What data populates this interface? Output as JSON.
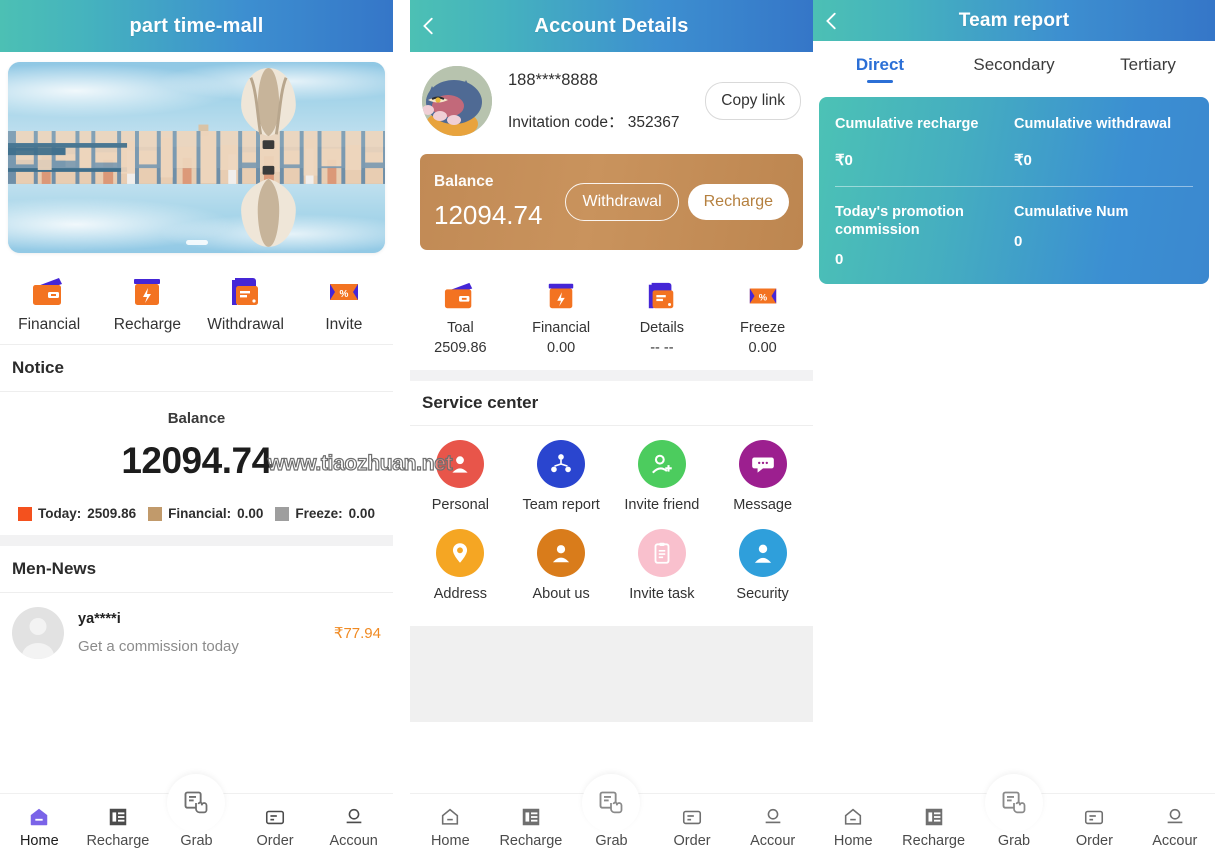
{
  "panel1": {
    "header": {
      "title": "part time-mall"
    },
    "hero": {
      "icon": "city-banner-image",
      "indicator": "carousel-dot"
    },
    "quick_actions": [
      {
        "label": "Financial",
        "icon": "wallet-icon"
      },
      {
        "label": "Recharge",
        "icon": "recharge-icon"
      },
      {
        "label": "Withdrawal",
        "icon": "withdrawal-icon"
      },
      {
        "label": "Invite",
        "icon": "coupon-percent-icon"
      }
    ],
    "notice_title": "Notice",
    "balance": {
      "caption": "Balance",
      "value": "12094.74",
      "legend": [
        {
          "label": "Today:",
          "value": "2509.86",
          "color": "#f4511e"
        },
        {
          "label": "Financial:",
          "value": "0.00",
          "color": "#c19a6b"
        },
        {
          "label": "Freeze:",
          "value": "0.00",
          "color": "#9e9e9e"
        }
      ]
    },
    "news_title": "Men-News",
    "news": [
      {
        "name": "ya****i",
        "text": "Get a commission today",
        "amount": "₹77.94"
      }
    ],
    "tabbar": [
      {
        "label": "Home",
        "icon": "home-icon",
        "active": true
      },
      {
        "label": "Recharge",
        "icon": "receipt-icon",
        "active": false
      },
      {
        "label": "Grab",
        "icon": "grab-hand-icon",
        "active": false
      },
      {
        "label": "Order",
        "icon": "order-list-icon",
        "active": false
      },
      {
        "label": "Accoun",
        "icon": "account-person-icon",
        "active": false
      }
    ]
  },
  "panel2": {
    "header": {
      "title": "Account Details",
      "back_icon": "chevron-left-icon"
    },
    "account": {
      "avatar": "cat-avatar",
      "phone": "188****8888",
      "invitation_label": "Invitation code：",
      "invitation_code": "352367",
      "copy_label": "Copy link"
    },
    "balance_card": {
      "caption": "Balance",
      "value": "12094.74",
      "withdrawal_label": "Withdrawal",
      "recharge_label": "Recharge",
      "card_color": "#c38f58"
    },
    "stats": [
      {
        "label": "Toal",
        "value": "2509.86",
        "icon": "wallet-icon"
      },
      {
        "label": "Financial",
        "value": "0.00",
        "icon": "recharge-icon"
      },
      {
        "label": "Details",
        "value": "-- --",
        "icon": "withdrawal-icon"
      },
      {
        "label": "Freeze",
        "value": "0.00",
        "icon": "coupon-percent-icon"
      }
    ],
    "service_title": "Service center",
    "services": [
      {
        "label": "Personal",
        "icon": "person-circle-icon",
        "color": "#e8554a"
      },
      {
        "label": "Team report",
        "icon": "team-network-icon",
        "color": "#2a45cf"
      },
      {
        "label": "Invite friend",
        "icon": "person-add-icon",
        "color": "#4ccc5e"
      },
      {
        "label": "Message",
        "icon": "chat-bubble-icon",
        "color": "#9c1f8f"
      },
      {
        "label": "Address",
        "icon": "location-pin-icon",
        "color": "#f5a623"
      },
      {
        "label": "About us",
        "icon": "person-icon",
        "color": "#d97c1b"
      },
      {
        "label": "Invite task",
        "icon": "clipboard-icon",
        "color": "#f9c0cd"
      },
      {
        "label": "Security",
        "icon": "person-shield-icon",
        "color": "#2f9fdb"
      }
    ],
    "tabbar": [
      {
        "label": "Home",
        "icon": "home-icon",
        "active": false
      },
      {
        "label": "Recharge",
        "icon": "receipt-icon",
        "active": false
      },
      {
        "label": "Grab",
        "icon": "grab-hand-icon",
        "active": false
      },
      {
        "label": "Order",
        "icon": "order-list-icon",
        "active": false
      },
      {
        "label": "Accour",
        "icon": "account-person-icon",
        "active": false
      }
    ]
  },
  "panel3": {
    "header": {
      "title": "Team report",
      "back_icon": "chevron-left-icon"
    },
    "tabs": [
      {
        "label": "Direct",
        "active": true
      },
      {
        "label": "Secondary",
        "active": false
      },
      {
        "label": "Tertiary",
        "active": false
      }
    ],
    "report": {
      "cells": [
        {
          "key": "Cumulative recharge",
          "value": "₹0"
        },
        {
          "key": "Cumulative withdrawal",
          "value": "₹0"
        },
        {
          "key": "Today's promotion commission",
          "value": "0"
        },
        {
          "key": "Cumulative Num",
          "value": "0"
        }
      ]
    },
    "tabbar": [
      {
        "label": "Home",
        "icon": "home-icon",
        "active": false
      },
      {
        "label": "Recharge",
        "icon": "receipt-icon",
        "active": false
      },
      {
        "label": "Grab",
        "icon": "grab-hand-icon",
        "active": false
      },
      {
        "label": "Order",
        "icon": "order-list-icon",
        "active": false
      },
      {
        "label": "Accour",
        "icon": "account-person-icon",
        "active": false
      }
    ]
  },
  "watermark": {
    "text": "www.tiaozhuan.net"
  }
}
